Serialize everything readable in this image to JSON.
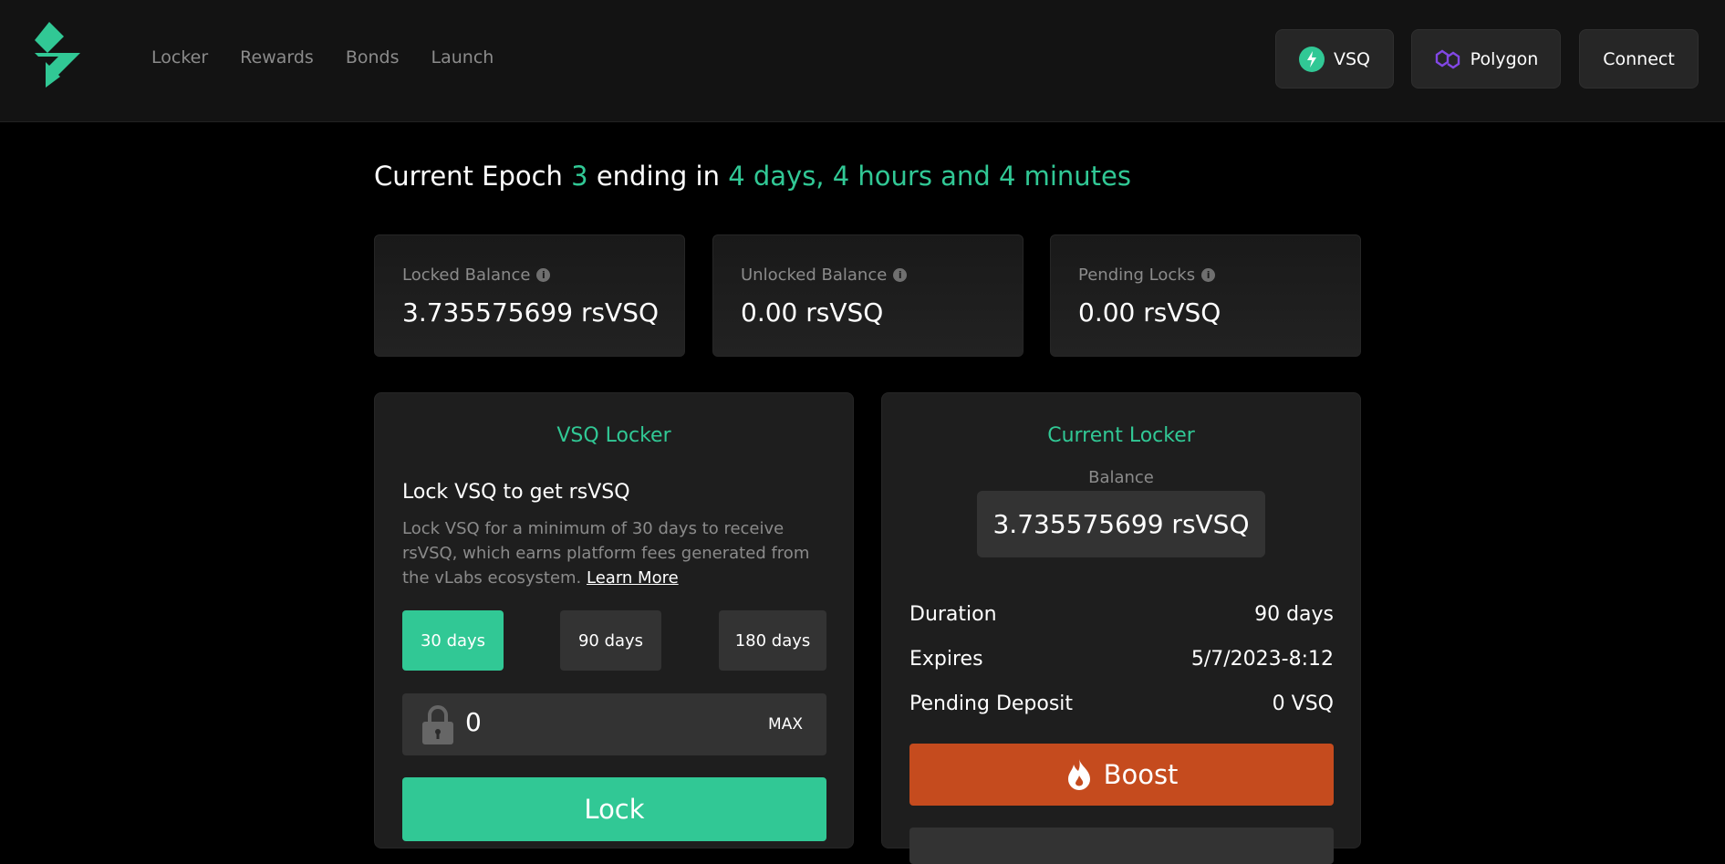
{
  "colors": {
    "accent": "#31c895",
    "boost": "#c54b1e",
    "polygon": "#8247e5",
    "background": "#000000",
    "header": "#131313",
    "card": "#1e1e1e",
    "muted": "#8b8b8b"
  },
  "nav": {
    "logo_icon": "bolt-logo-icon",
    "items": [
      {
        "label": "Locker"
      },
      {
        "label": "Rewards"
      },
      {
        "label": "Bonds"
      },
      {
        "label": "Launch"
      }
    ]
  },
  "header": {
    "token_button": {
      "label": "VSQ",
      "icon": "vsq-token-icon"
    },
    "network_button": {
      "label": "Polygon",
      "icon": "polygon-icon"
    },
    "connect_button": {
      "label": "Connect"
    }
  },
  "epoch": {
    "prefix": "Current Epoch",
    "number": "3",
    "middle": "ending in",
    "remaining": "4 days, 4 hours and 4 minutes"
  },
  "stats": [
    {
      "label": "Locked Balance",
      "value": "3.735575699 rsVSQ",
      "icon": "info-icon"
    },
    {
      "label": "Unlocked Balance",
      "value": "0.00 rsVSQ",
      "icon": "info-icon"
    },
    {
      "label": "Pending Locks",
      "value": "0.00 rsVSQ",
      "icon": "info-icon"
    }
  ],
  "locker": {
    "title": "VSQ Locker",
    "heading": "Lock VSQ to get rsVSQ",
    "description": "Lock VSQ for a minimum of 30 days to receive rsVSQ, which earns platform fees generated from the vLabs ecosystem.",
    "learn_more": "Learn More",
    "durations": [
      {
        "label": "30 days",
        "selected": true
      },
      {
        "label": "90 days",
        "selected": false
      },
      {
        "label": "180 days",
        "selected": false
      }
    ],
    "amount": {
      "value": "0",
      "icon": "padlock-icon",
      "max_label": "MAX"
    },
    "lock_button": "Lock"
  },
  "current_locker": {
    "title": "Current Locker",
    "balance_label": "Balance",
    "balance_value": "3.735575699 rsVSQ",
    "rows": [
      {
        "label": "Duration",
        "value": "90 days"
      },
      {
        "label": "Expires",
        "value": "5/7/2023-8:12"
      },
      {
        "label": "Pending Deposit",
        "value": "0 VSQ"
      }
    ],
    "boost_button": {
      "label": "Boost",
      "icon": "flame-icon"
    }
  }
}
